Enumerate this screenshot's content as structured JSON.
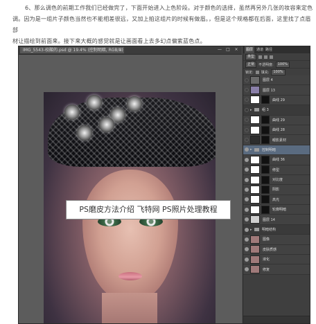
{
  "article": {
    "line1": "6、那么调色的前期工作我们已经做完了，下面开始进入上色阶段。对于颜色的选择，虽然再另外几张的妆容来定色",
    "line2": "调。因为是一组片子颜色当然也不能相差很远，又加上拍这组片的时候有做眉。，但是这个规格都在后面，这里找了点眉部",
    "line3": "材让描绘到前面来。接下来大概的感觉就是让画面看上去多幻点偏紫蓝色点。"
  },
  "window": {
    "tab_title": "IMG_5543-校酸的.psd @ 19.4% (控制明暗, RGB/8)",
    "tab_close": "×",
    "btn_min": "—",
    "btn_max": "□",
    "btn_close": "×"
  },
  "caption": "PS磨皮方法介绍 飞特网 PS照片处理教程",
  "panel": {
    "tabs": [
      "图层",
      "通道",
      "路径"
    ],
    "kind_label": "类型",
    "blend_mode": "正常",
    "opacity_label": "不透明度:",
    "opacity_value": "100%",
    "lock_label": "锁定:",
    "fill_label": "填充:",
    "fill_value": "100%",
    "layers": [
      {
        "name": "图层 4",
        "thumb": "#6b6b6b",
        "mask": false,
        "visible": false,
        "group": false
      },
      {
        "name": "图层 13",
        "thumb": "#8a7fa8",
        "mask": false,
        "visible": false,
        "group": false
      },
      {
        "name": "曲线 29",
        "thumb": "#ffffff",
        "mask": true,
        "visible": false,
        "group": false
      },
      {
        "name": "组 3",
        "thumb": "",
        "mask": false,
        "visible": false,
        "group": true
      },
      {
        "name": "曲线 29",
        "thumb": "#ffffff",
        "mask": true,
        "visible": false,
        "group": false
      },
      {
        "name": "曲线 28",
        "thumb": "#ffffff",
        "mask": true,
        "visible": false,
        "group": false
      },
      {
        "name": "眼影素材",
        "thumb": "#2d2d2d",
        "mask": true,
        "visible": false,
        "group": false
      },
      {
        "name": "控制明暗",
        "thumb": "",
        "mask": false,
        "visible": true,
        "group": true
      },
      {
        "name": "曲线 36",
        "thumb": "#ffffff",
        "mask": true,
        "visible": true,
        "group": false
      },
      {
        "name": "修型",
        "thumb": "#ffffff",
        "mask": true,
        "visible": true,
        "group": false
      },
      {
        "name": "对比度",
        "thumb": "#ffffff",
        "mask": true,
        "visible": true,
        "group": false
      },
      {
        "name": "阴影",
        "thumb": "#ffffff",
        "mask": true,
        "visible": true,
        "group": false
      },
      {
        "name": "高光",
        "thumb": "#ffffff",
        "mask": true,
        "visible": true,
        "group": false
      },
      {
        "name": "轮廓明暗",
        "thumb": "#ffffff",
        "mask": true,
        "visible": true,
        "group": false
      },
      {
        "name": "图层 14",
        "thumb": "#cfcfcf",
        "mask": false,
        "visible": true,
        "group": false
      },
      {
        "name": "明暗结构",
        "thumb": "",
        "mask": false,
        "visible": true,
        "group": true
      },
      {
        "name": "图像",
        "thumb": "#a07a7a",
        "mask": false,
        "visible": true,
        "group": false
      },
      {
        "name": "皮肤质感",
        "thumb": "#a07a7a",
        "mask": false,
        "visible": true,
        "group": false
      },
      {
        "name": "液化",
        "thumb": "#a07a7a",
        "mask": false,
        "visible": true,
        "group": false
      },
      {
        "name": "修复",
        "thumb": "#a07a7a",
        "mask": false,
        "visible": true,
        "group": false
      }
    ]
  }
}
